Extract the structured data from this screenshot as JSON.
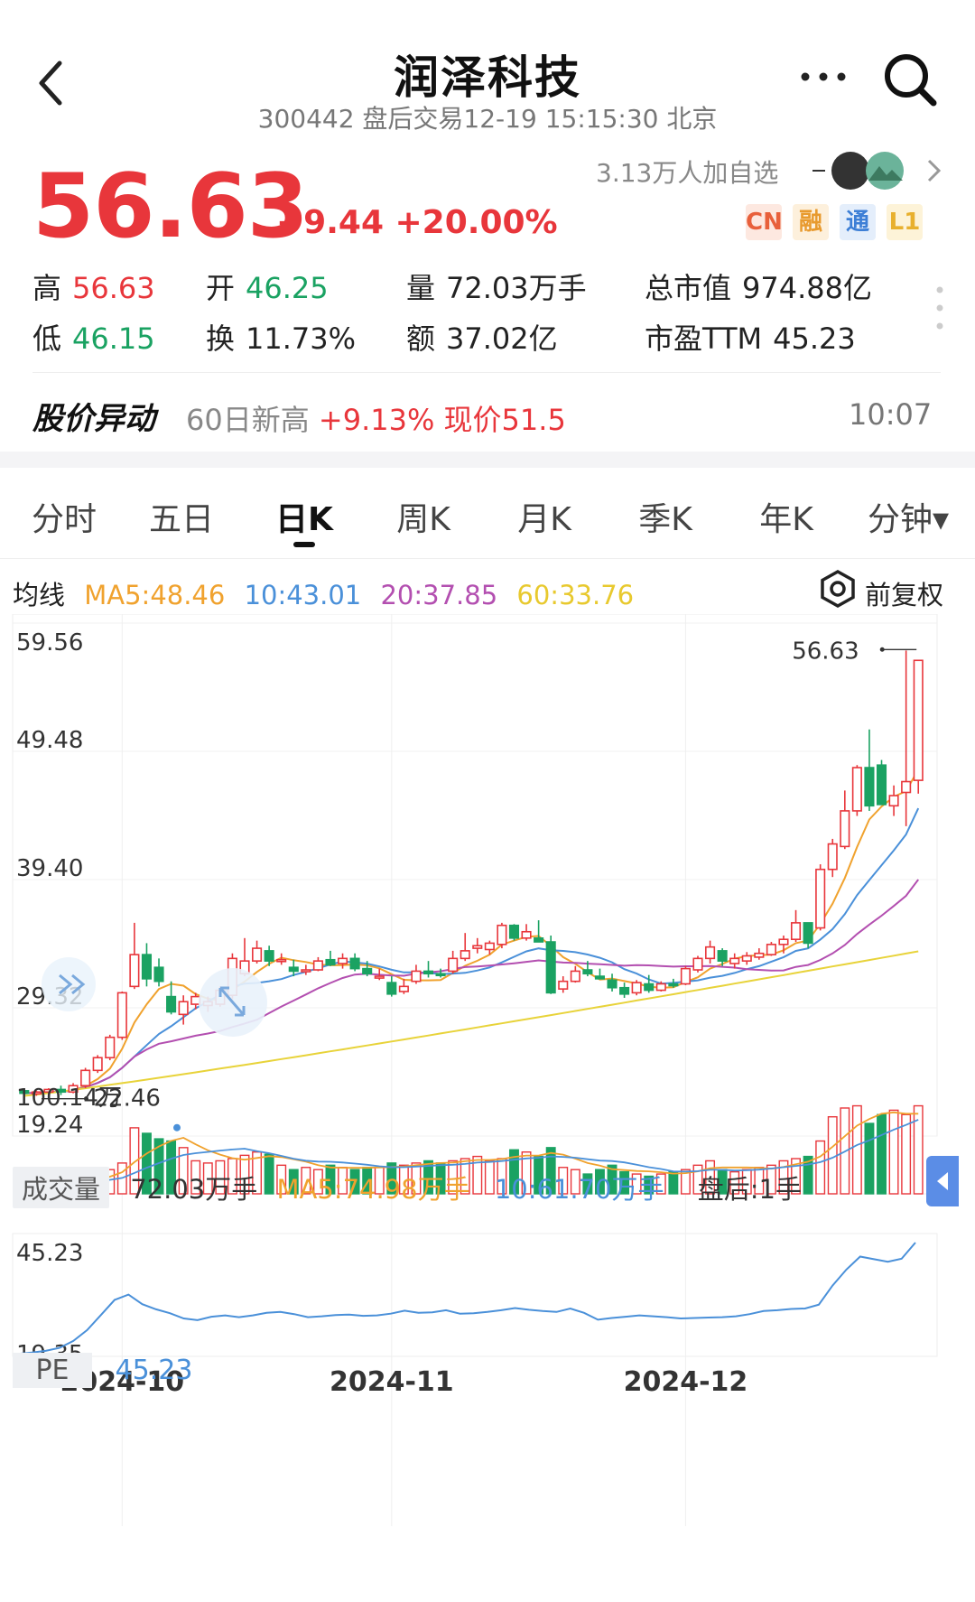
{
  "header": {
    "title": "润泽科技",
    "subtitle": "300442 盘后交易12-19 15:15:30 北京"
  },
  "quote": {
    "price": "56.63",
    "change": "+9.44 +20.00%",
    "watchers": "3.13万人加自选",
    "tags": [
      "CN",
      "融",
      "通",
      "L1"
    ],
    "stats": {
      "high_label": "高",
      "high": "56.63",
      "open_label": "开",
      "open": "46.25",
      "volume_label": "量",
      "volume": "72.03万手",
      "mcap_label": "总市值",
      "mcap": "974.88亿",
      "low_label": "低",
      "low": "46.15",
      "turnover_label": "换",
      "turnover": "11.73%",
      "amount_label": "额",
      "amount": "37.02亿",
      "pe_label": "市盈TTM",
      "pe": "45.23"
    }
  },
  "alert": {
    "title": "股价异动",
    "text_prefix": "60日新高",
    "text_value": "+9.13% 现价51.5",
    "time": "10:07"
  },
  "tabs": [
    "分时",
    "五日",
    "日K",
    "周K",
    "月K",
    "季K",
    "年K",
    "分钟▾"
  ],
  "active_tab": "日K",
  "ma": {
    "label": "均线",
    "ma5": "MA5:48.46",
    "ma10": "10:43.01",
    "ma20": "20:37.85",
    "ma60": "60:33.76",
    "adjust_label": "前复权"
  },
  "colors": {
    "up": "#e8363b",
    "down": "#1aa262",
    "ma5": "#f0a22e",
    "ma10": "#4a90d9",
    "ma20": "#b34fb0",
    "ma60": "#e8d33a"
  },
  "volume": {
    "label": "成交量",
    "value": "72.03万手",
    "ma5": "MA5:74.98万手",
    "ma10": "10:61.70万手",
    "after_hours": "盘后:1手",
    "axis_max": "100.14万"
  },
  "pe_panel": {
    "label": "PE",
    "value": "45.23",
    "axis_max": "45.23",
    "axis_min": "19.35"
  },
  "chart_data": {
    "type": "candlestick",
    "y_ticks": [
      "59.56",
      "49.48",
      "39.40",
      "29.32",
      "19.24"
    ],
    "ylim": [
      19.24,
      59.56
    ],
    "high_label": "56.63",
    "low_label": "22.46",
    "x_ticks": [
      "2024-10",
      "2024-11",
      "2024-12"
    ],
    "candles": [
      [
        22.8,
        22.9,
        22.5,
        22.6
      ],
      [
        22.6,
        22.8,
        22.4,
        22.7
      ],
      [
        22.7,
        23.0,
        22.6,
        22.9
      ],
      [
        22.9,
        23.2,
        22.46,
        22.7
      ],
      [
        22.7,
        23.4,
        22.6,
        23.2
      ],
      [
        23.2,
        24.6,
        23.0,
        24.4
      ],
      [
        24.4,
        25.6,
        24.2,
        25.4
      ],
      [
        25.4,
        27.2,
        25.2,
        27.0
      ],
      [
        27.0,
        30.6,
        26.8,
        30.5
      ],
      [
        31.0,
        36.0,
        30.8,
        33.5
      ],
      [
        33.5,
        34.4,
        31.0,
        31.6
      ],
      [
        32.5,
        33.2,
        31.0,
        31.4
      ],
      [
        30.2,
        31.4,
        28.8,
        29.0
      ],
      [
        28.8,
        30.3,
        28.0,
        29.8
      ],
      [
        29.6,
        30.5,
        29.2,
        30.2
      ],
      [
        29.5,
        30.2,
        29.0,
        29.8
      ],
      [
        29.6,
        31.0,
        29.4,
        30.7
      ],
      [
        30.3,
        33.6,
        30.0,
        33.2
      ],
      [
        32.0,
        34.8,
        31.8,
        33.0
      ],
      [
        33.0,
        34.6,
        32.8,
        34.0
      ],
      [
        33.8,
        34.2,
        32.6,
        33.0
      ],
      [
        33.0,
        33.6,
        32.7,
        33.1
      ],
      [
        32.5,
        33.1,
        31.8,
        32.2
      ],
      [
        32.2,
        32.7,
        31.9,
        32.3
      ],
      [
        32.3,
        33.3,
        32.2,
        33.0
      ],
      [
        33.1,
        33.8,
        32.6,
        32.7
      ],
      [
        32.8,
        33.6,
        32.4,
        33.2
      ],
      [
        33.2,
        33.6,
        32.2,
        32.4
      ],
      [
        32.4,
        33.0,
        31.8,
        32.0
      ],
      [
        31.8,
        32.4,
        31.5,
        31.8
      ],
      [
        31.3,
        31.8,
        30.2,
        30.4
      ],
      [
        30.6,
        31.6,
        30.4,
        31.0
      ],
      [
        31.4,
        32.7,
        31.2,
        32.2
      ],
      [
        32.2,
        33.0,
        31.7,
        32.0
      ],
      [
        32.0,
        32.4,
        31.7,
        31.9
      ],
      [
        32.2,
        33.8,
        32.0,
        33.2
      ],
      [
        33.2,
        35.2,
        33.0,
        33.8
      ],
      [
        34.0,
        34.8,
        33.6,
        34.2
      ],
      [
        33.9,
        34.6,
        33.5,
        34.4
      ],
      [
        34.3,
        36.0,
        34.0,
        35.8
      ],
      [
        35.8,
        35.9,
        34.6,
        34.8
      ],
      [
        34.8,
        35.9,
        34.6,
        35.3
      ],
      [
        34.8,
        36.2,
        34.5,
        34.5
      ],
      [
        34.5,
        35.0,
        30.4,
        30.5
      ],
      [
        30.8,
        31.8,
        30.5,
        31.4
      ],
      [
        31.4,
        32.6,
        31.3,
        32.2
      ],
      [
        32.3,
        33.0,
        31.8,
        32.0
      ],
      [
        31.8,
        32.4,
        31.6,
        31.6
      ],
      [
        31.5,
        32.0,
        30.6,
        30.9
      ],
      [
        30.9,
        31.3,
        30.1,
        30.4
      ],
      [
        30.5,
        31.5,
        30.3,
        31.3
      ],
      [
        31.2,
        31.9,
        30.5,
        30.7
      ],
      [
        30.7,
        31.4,
        30.6,
        31.2
      ],
      [
        31.2,
        31.6,
        30.9,
        31.1
      ],
      [
        31.2,
        32.6,
        31.1,
        32.4
      ],
      [
        32.3,
        33.4,
        32.1,
        33.2
      ],
      [
        33.2,
        34.6,
        32.8,
        34.1
      ],
      [
        33.8,
        34.0,
        32.6,
        33.0
      ],
      [
        32.8,
        33.6,
        32.4,
        33.2
      ],
      [
        33.0,
        33.7,
        32.7,
        33.4
      ],
      [
        33.3,
        34.0,
        33.1,
        33.6
      ],
      [
        33.5,
        34.5,
        33.4,
        34.3
      ],
      [
        34.3,
        35.0,
        33.6,
        34.7
      ],
      [
        34.7,
        37.0,
        34.5,
        36.0
      ],
      [
        36.0,
        35.5,
        34.0,
        34.4
      ],
      [
        35.6,
        40.6,
        35.4,
        40.2
      ],
      [
        40.2,
        42.6,
        39.6,
        42.2
      ],
      [
        42.0,
        46.4,
        41.8,
        44.8
      ],
      [
        44.8,
        48.4,
        44.4,
        48.2
      ],
      [
        48.2,
        51.2,
        44.8,
        45.2
      ],
      [
        48.4,
        48.8,
        46.1,
        45.3
      ],
      [
        45.2,
        46.8,
        44.4,
        46.0
      ],
      [
        46.25,
        57.4,
        43.6,
        47.1
      ],
      [
        47.2,
        56.63,
        46.15,
        56.63
      ]
    ],
    "volume_values": [
      8,
      8,
      8,
      8,
      14,
      16,
      18,
      22,
      28,
      60,
      55,
      50,
      48,
      42,
      30,
      28,
      30,
      32,
      35,
      38,
      36,
      26,
      22,
      24,
      22,
      26,
      24,
      22,
      24,
      24,
      28,
      26,
      28,
      30,
      28,
      30,
      32,
      34,
      30,
      32,
      40,
      38,
      34,
      42,
      24,
      22,
      18,
      22,
      26,
      20,
      18,
      16,
      18,
      20,
      22,
      26,
      30,
      22,
      20,
      22,
      24,
      26,
      30,
      32,
      34,
      48,
      70,
      78,
      80,
      64,
      72,
      76,
      72,
      80
    ],
    "volume_ylim": [
      0,
      100.14
    ],
    "pe_values": [
      19.5,
      19.8,
      20.2,
      20.9,
      22.5,
      25.0,
      28.5,
      32.0,
      33.2,
      31.0,
      29.8,
      28.9,
      27.7,
      27.3,
      28.1,
      28.4,
      28.0,
      28.4,
      29.0,
      29.2,
      28.7,
      28.0,
      28.2,
      28.5,
      28.6,
      28.3,
      28.4,
      28.8,
      29.5,
      29.0,
      29.1,
      29.6,
      28.8,
      28.9,
      29.2,
      29.6,
      30.1,
      29.7,
      29.4,
      29.2,
      30.0,
      29.0,
      27.4,
      27.8,
      28.1,
      28.4,
      28.2,
      28.0,
      27.7,
      27.8,
      27.9,
      28.0,
      28.2,
      28.7,
      29.4,
      29.6,
      29.9,
      30.0,
      30.9,
      35.3,
      39.0,
      42.0,
      41.4,
      40.8,
      41.5,
      45.23
    ],
    "pe_ylim": [
      19.35,
      45.23
    ]
  }
}
